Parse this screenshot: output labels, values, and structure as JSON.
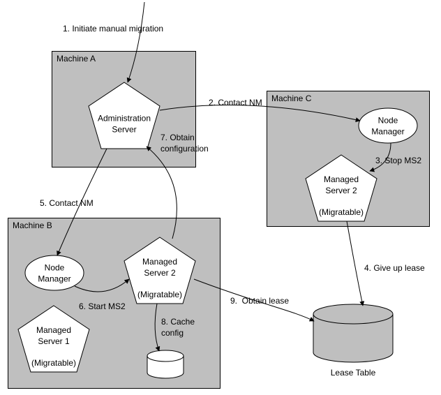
{
  "machines": {
    "a": {
      "title": "Machine A",
      "admin_server": "Administration\nServer"
    },
    "b": {
      "title": "Machine B",
      "node_manager": "Node\nManager",
      "ms1": "Managed\nServer 1\n\n(Migratable)",
      "ms2": "Managed\nServer 2\n\n(Migratable)"
    },
    "c": {
      "title": "Machine C",
      "node_manager": "Node\nManager",
      "ms2": "Managed\nServer 2\n\n(Migratable)"
    }
  },
  "lease_table": "Lease Table",
  "steps": {
    "s1": "1. Initiate manual migration",
    "s2": "2. Contact NM",
    "s3": "3. Stop MS2",
    "s4": "4. Give up lease",
    "s5": "5. Contact NM",
    "s6": "6. Start MS2",
    "s7": "7. Obtain\nconfiguration",
    "s8": "8. Cache\nconfig",
    "s9": "9.  Obtain lease"
  },
  "chart_data": {
    "type": "diagram",
    "nodes": [
      {
        "id": "admin_server",
        "label": "Administration Server",
        "container": "Machine A",
        "shape": "pentagon"
      },
      {
        "id": "nm_b",
        "label": "Node Manager",
        "container": "Machine B",
        "shape": "ellipse"
      },
      {
        "id": "ms1_b",
        "label": "Managed Server 1 (Migratable)",
        "container": "Machine B",
        "shape": "pentagon"
      },
      {
        "id": "ms2_b",
        "label": "Managed Server 2 (Migratable)",
        "container": "Machine B",
        "shape": "pentagon"
      },
      {
        "id": "cache_b",
        "label": "cache config cylinder",
        "container": "Machine B",
        "shape": "cylinder"
      },
      {
        "id": "nm_c",
        "label": "Node Manager",
        "container": "Machine C",
        "shape": "ellipse"
      },
      {
        "id": "ms2_c",
        "label": "Managed Server 2 (Migratable)",
        "container": "Machine C",
        "shape": "pentagon"
      },
      {
        "id": "lease_table",
        "label": "Lease Table",
        "container": null,
        "shape": "cylinder"
      }
    ],
    "edges": [
      {
        "from": "external",
        "to": "admin_server",
        "label": "1. Initiate manual migration"
      },
      {
        "from": "admin_server",
        "to": "nm_c",
        "label": "2. Contact NM"
      },
      {
        "from": "nm_c",
        "to": "ms2_c",
        "label": "3. Stop MS2"
      },
      {
        "from": "ms2_c",
        "to": "lease_table",
        "label": "4. Give up lease"
      },
      {
        "from": "admin_server",
        "to": "nm_b",
        "label": "5. Contact NM"
      },
      {
        "from": "nm_b",
        "to": "ms2_b",
        "label": "6. Start MS2"
      },
      {
        "from": "ms2_b",
        "to": "admin_server",
        "label": "7. Obtain configuration"
      },
      {
        "from": "ms2_b",
        "to": "cache_b",
        "label": "8. Cache config"
      },
      {
        "from": "ms2_b",
        "to": "lease_table",
        "label": "9. Obtain lease"
      }
    ]
  }
}
